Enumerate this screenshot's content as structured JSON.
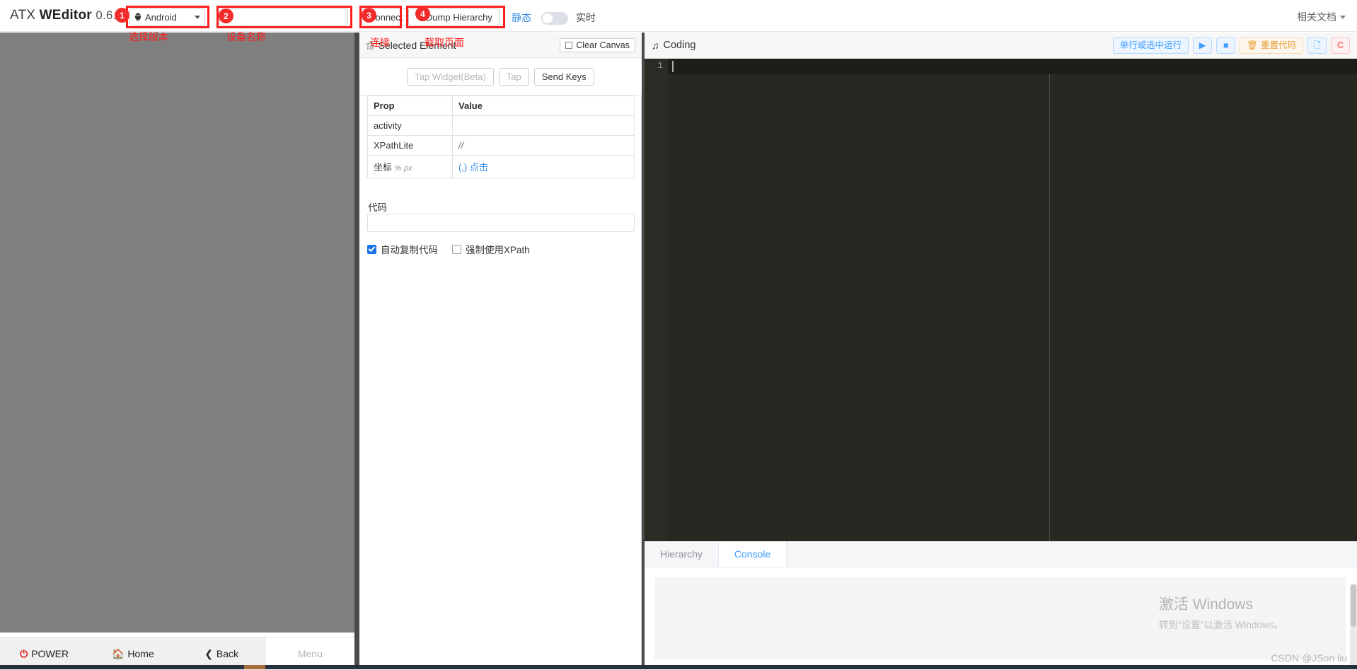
{
  "toolbar": {
    "app_name_prefix": "ATX ",
    "app_name_strong": "WEditor",
    "version": "0.6.4",
    "platform_value": "Android",
    "platform_icon": "android-icon",
    "device_value": "",
    "device_placeholder": "",
    "connect_label": "Connect",
    "dump_label": "Dump Hierarchy",
    "dump_icon": "refresh-icon",
    "static_label": "静态",
    "live_label": "实时",
    "toggle_state": "off",
    "docs_label": "相关文档",
    "badges": [
      "1",
      "2",
      "3",
      "4"
    ],
    "annotations": [
      {
        "text": "选择版本"
      },
      {
        "text": "设备名称"
      },
      {
        "text": "连接"
      },
      {
        "text": "截取页面"
      }
    ]
  },
  "device": {
    "canvas_color": "#7f7f7f",
    "keys": [
      {
        "label": "POWER",
        "icon": "power-icon",
        "disabled": false
      },
      {
        "label": "Home",
        "icon": "home-icon",
        "disabled": false
      },
      {
        "label": "Back",
        "icon": "chevron-left-icon",
        "disabled": false
      },
      {
        "label": "Menu",
        "icon": "menu-icon",
        "disabled": true
      }
    ]
  },
  "inspector": {
    "title": "Selected Element",
    "title_icon": "target-icon",
    "clear_canvas_label": "Clear Canvas",
    "actions": [
      {
        "label": "Tap Widget(Beta)",
        "muted": true
      },
      {
        "label": "Tap",
        "muted": true
      },
      {
        "label": "Send Keys",
        "muted": false
      }
    ],
    "table": {
      "headers": [
        "Prop",
        "Value"
      ],
      "rows": [
        {
          "prop": "activity",
          "value": ""
        },
        {
          "prop": "XPathLite",
          "value": "//"
        },
        {
          "prop": "坐标",
          "prop_unit_pct": "%",
          "prop_unit_px": "px",
          "value": "(,)",
          "value_link": "点击"
        }
      ]
    },
    "code_label": "代码",
    "code_value": "",
    "code_placeholder": "",
    "auto_copy_label": "自动复制代码",
    "auto_copy_checked": true,
    "force_xpath_label": "强制使用XPath",
    "force_xpath_checked": false
  },
  "coding": {
    "title": "Coding",
    "title_icon": "music-note-icon",
    "buttons": [
      {
        "label": "单行或选中运行",
        "style": "blue",
        "icon": ""
      },
      {
        "label": "",
        "style": "icon-blue",
        "icon": "play-icon"
      },
      {
        "label": "",
        "style": "icon-blue",
        "icon": "stop-icon"
      },
      {
        "label": "重置代码",
        "style": "orange",
        "icon": "trash-icon"
      },
      {
        "label": "",
        "style": "icon-blue",
        "icon": "copy-icon"
      },
      {
        "label": "C",
        "style": "red",
        "icon": "refresh-icon"
      }
    ],
    "editor": {
      "line_number": "1",
      "content": "",
      "theme": "#272822"
    },
    "tabs": [
      {
        "label": "Hierarchy",
        "active": false
      },
      {
        "label": "Console",
        "active": true
      }
    ],
    "console_content": ""
  },
  "watermarks": {
    "windows_title": "激活 Windows",
    "windows_sub": "转到\"设置\"以激活 Windows。",
    "csdn": "CSDN @JSon  liu"
  },
  "colors": {
    "accent_blue": "#409eff",
    "warn_orange": "#e6a23c",
    "danger_red": "#f56c6c",
    "annotation_red": "#fb1e1e",
    "canvas_gray": "#7f7f7f",
    "editor_bg": "#272822"
  }
}
